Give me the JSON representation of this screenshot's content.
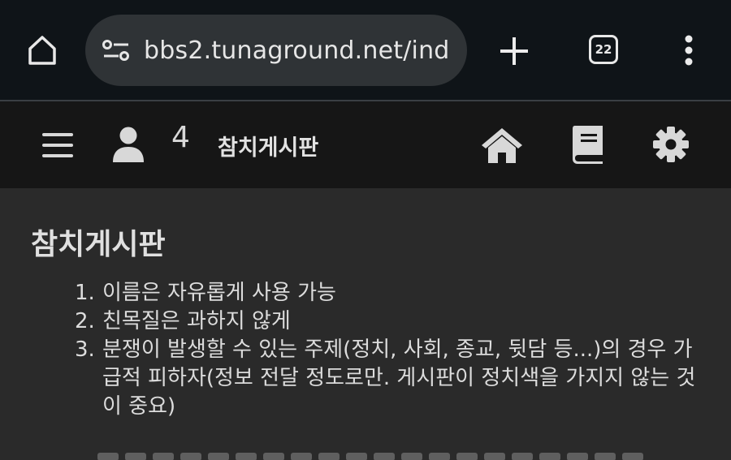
{
  "browser": {
    "url": "bbs2.tunaground.net/ind",
    "tab_count": "22"
  },
  "header": {
    "user_count": "4",
    "board_name": "참치게시판"
  },
  "main": {
    "title": "참치게시판",
    "rules": [
      {
        "num": "1.",
        "text": "이름은 자유롭게 사용 가능"
      },
      {
        "num": "2.",
        "text": "친목질은 과하지 않게"
      },
      {
        "num": "3.",
        "text": "분쟁이 발생할 수 있는 주제(정치, 사회, 종교, 뒷담 등...)의 경우 가급적 피하자(정보 전달 정도로만. 게시판이 정치색을 가지지 않는 것이 중요)"
      }
    ]
  },
  "colors": {
    "chrome_bg": "#0f1418",
    "url_bar_bg": "#2f3336",
    "header_bg": "#161616",
    "content_bg": "#2a2a2a",
    "text": "#dcdcdc"
  },
  "icons": [
    "home-icon",
    "tune-icon",
    "plus-icon",
    "tabs-icon",
    "more-vert-icon",
    "menu-icon",
    "user-icon",
    "home-icon",
    "book-icon",
    "gear-icon"
  ]
}
